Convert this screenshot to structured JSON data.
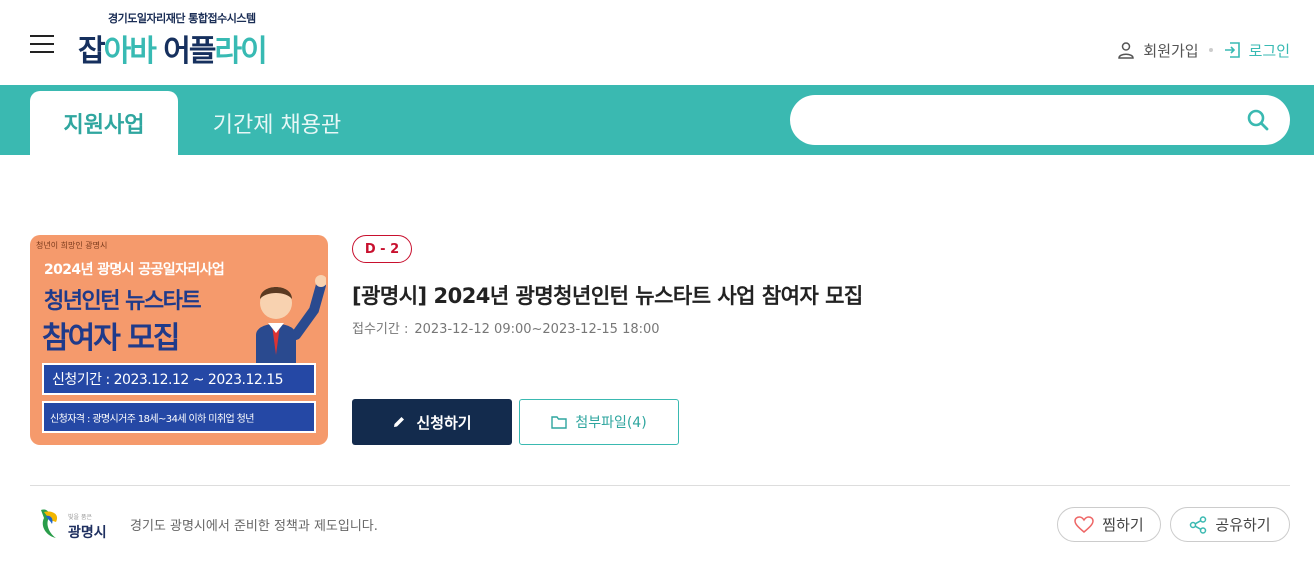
{
  "header": {
    "logo_sub": "경기도일자리재단 통합접수시스템",
    "logo_parts": [
      "잡",
      "아바 ",
      "어플",
      "라이"
    ],
    "join_label": "회원가입",
    "login_label": "로그인"
  },
  "nav": {
    "tabs": [
      {
        "label": "지원사업",
        "active": true
      },
      {
        "label": "기간제 채용관",
        "active": false
      }
    ],
    "search": {
      "placeholder": "",
      "value": ""
    }
  },
  "program": {
    "dday": "D - 2",
    "title": "[광명시] 2024년 광명청년인턴 뉴스타트 사업 참여자 모집",
    "period_label": "접수기간 :",
    "period_value": "2023-12-12 09:00~2023-12-15 18:00",
    "apply_label": "신청하기",
    "attach_label": "첨부파일(4)"
  },
  "poster": {
    "top_caption": "청년이 희망인 광명시",
    "line1": "2024년 광명시 공공일자리사업",
    "line2": "청년인턴 뉴스타트",
    "line3": "참여자 모집",
    "box1": "신청기간 : 2023.12.12 ~ 2023.12.15",
    "box2": "신청자격 : 광명시거주 18세~34세 이하 미취업 청년"
  },
  "footer": {
    "org_small": "빛을 품은",
    "org_name": "광명시",
    "text": "경기도 광명시에서 준비한 정책과 제도입니다.",
    "like_label": "찜하기",
    "share_label": "공유하기"
  },
  "colors": {
    "teal": "#3ab9b1",
    "navy": "#132b4d",
    "dday_red": "#c8102e"
  }
}
